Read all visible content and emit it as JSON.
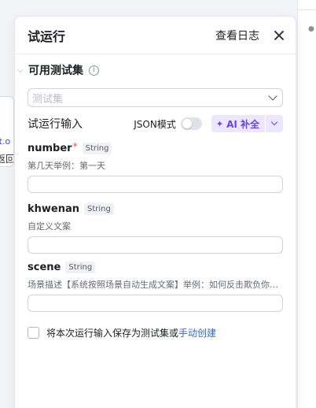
{
  "background": {
    "node_text_top": "ft.o",
    "node_text_bottom": "返回"
  },
  "panel": {
    "title": "试运行",
    "log_link": "查看日志"
  },
  "test_set": {
    "title": "可用测试集",
    "select_placeholder": "测试集"
  },
  "run_input": {
    "title": "试运行输入",
    "json_mode_label": "JSON模式",
    "json_mode_on": false,
    "ai_fill_label": "AI 补全"
  },
  "fields": [
    {
      "name": "number",
      "required": "*",
      "type": "String",
      "description": "第几天举例：第一天",
      "value": ""
    },
    {
      "name": "khwenan",
      "required": "",
      "type": "String",
      "description": "自定义文案",
      "value": ""
    },
    {
      "name": "scene",
      "required": "",
      "type": "String",
      "description": "场景描述【系统按照场景自动生成文案】举例：如何反击欺负你的人",
      "value": ""
    }
  ],
  "save": {
    "checked": false,
    "text": "将本次运行输入保存为测试集或",
    "link": "手动创建"
  },
  "colors": {
    "accent": "#6644e8",
    "link": "#3363e0",
    "required": "#f54a45"
  }
}
